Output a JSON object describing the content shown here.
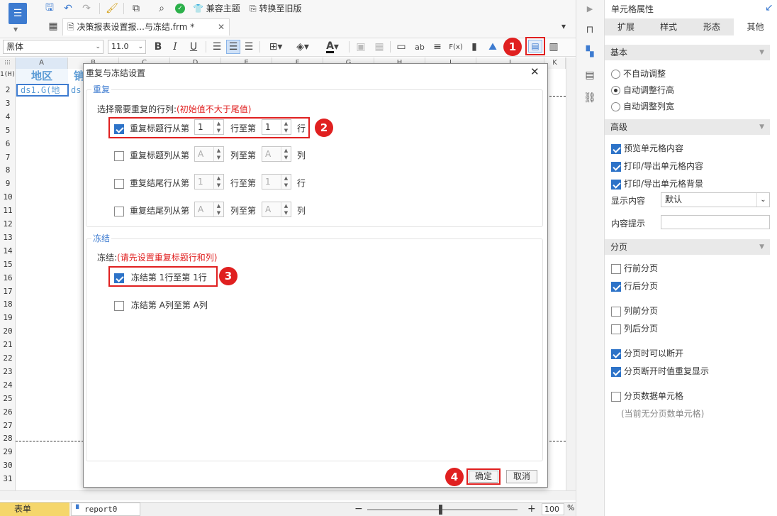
{
  "toolbar": {
    "theme_compat": "兼容主题",
    "convert_old": "转换至旧版",
    "font_name": "黑体",
    "font_size": "11.0",
    "fx": "F(x)",
    "ab": "ab"
  },
  "tab": {
    "title": "决策报表设置报...与冻结.frm *"
  },
  "sheet": {
    "columns": [
      "A",
      "B",
      "C",
      "D",
      "E",
      "F",
      "G",
      "H",
      "I",
      "J",
      "K"
    ],
    "corner": "1(H)",
    "row_numbers": [
      "2",
      "3",
      "4",
      "5",
      "6",
      "7",
      "8",
      "9",
      "10",
      "11",
      "12",
      "13",
      "14",
      "15",
      "16",
      "17",
      "18",
      "19",
      "20",
      "21",
      "22",
      "23",
      "24",
      "25",
      "26",
      "27",
      "28",
      "29",
      "30",
      "31"
    ],
    "cell_a1": "地区",
    "cell_b1": "销",
    "cell_a2": "ds1.G(地",
    "cell_b2": "ds"
  },
  "dialog": {
    "title": "重复与冻结设置",
    "repeat_section": "重复",
    "repeat_prompt": "选择需要重复的行列:",
    "repeat_hint": "(初始值不大于尾值)",
    "rows": [
      {
        "label": "重复标题行从第",
        "from": "1",
        "mid": "行至第",
        "to": "1",
        "unit": "行",
        "checked": true
      },
      {
        "label": "重复标题列从第",
        "from": "A",
        "mid": "列至第",
        "to": "A",
        "unit": "列",
        "checked": false
      },
      {
        "label": "重复结尾行从第",
        "from": "1",
        "mid": "行至第",
        "to": "1",
        "unit": "行",
        "checked": false
      },
      {
        "label": "重复结尾列从第",
        "from": "A",
        "mid": "列至第",
        "to": "A",
        "unit": "列",
        "checked": false
      }
    ],
    "freeze_section": "冻结",
    "freeze_prompt": "冻结:",
    "freeze_hint": "(请先设置重复标题行和列)",
    "freeze_rows": "冻结第 1行至第 1行",
    "freeze_cols": "冻结第 A列至第 A列",
    "ok": "确定",
    "cancel": "取消"
  },
  "badges": [
    "1",
    "2",
    "3",
    "4"
  ],
  "panel": {
    "title": "单元格属性",
    "tabs": [
      "扩展",
      "样式",
      "形态",
      "其他"
    ],
    "basic": "基本",
    "radios": [
      {
        "label": "不自动调整",
        "on": false
      },
      {
        "label": "自动调整行高",
        "on": true
      },
      {
        "label": "自动调整列宽",
        "on": false
      }
    ],
    "advanced": "高级",
    "adv_checks": [
      "预览单元格内容",
      "打印/导出单元格内容",
      "打印/导出单元格背景"
    ],
    "display_label": "显示内容",
    "display_value": "默认",
    "tip_label": "内容提示",
    "paging": "分页",
    "paging_checks": [
      {
        "label": "行前分页",
        "on": false
      },
      {
        "label": "行后分页",
        "on": true
      },
      {
        "label": "列前分页",
        "on": false
      },
      {
        "label": "列后分页",
        "on": false
      },
      {
        "label": "分页时可以断开",
        "on": true
      },
      {
        "label": "分页断开时值重复显示",
        "on": true
      },
      {
        "label": "分页数据单元格",
        "on": false
      }
    ],
    "paging_note": "(当前无分页数单元格)"
  },
  "statusbar": {
    "sheet_tab": "表单",
    "report_tab": "report0",
    "zoom": "100",
    "percent": "%"
  },
  "colors": {
    "accent": "#2d73c8",
    "red": "#e02020",
    "header_blue": "#5b9bd5"
  }
}
